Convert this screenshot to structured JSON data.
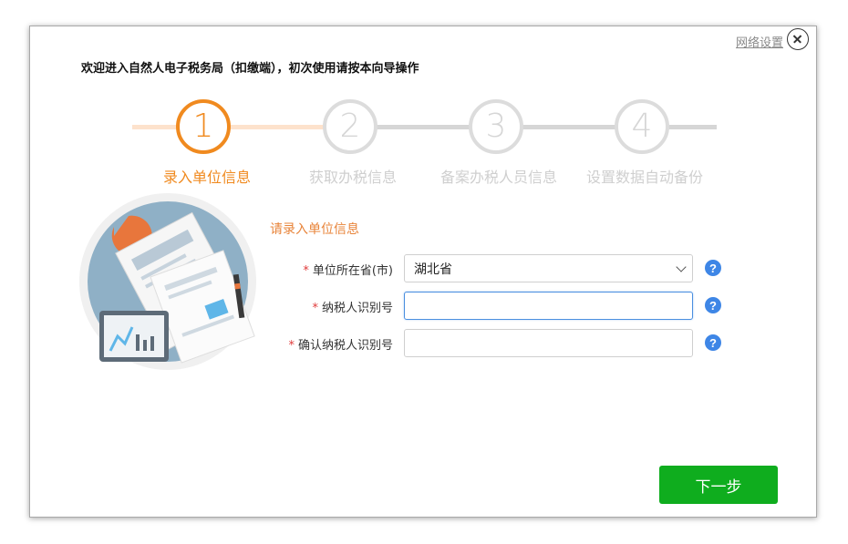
{
  "window": {
    "network_settings": "网络设置",
    "welcome": "欢迎进入自然人电子税务局（扣缴端），初次使用请按本向导操作"
  },
  "steps": [
    {
      "number": "1",
      "label": "录入单位信息",
      "active": true
    },
    {
      "number": "2",
      "label": "获取办税信息",
      "active": false
    },
    {
      "number": "3",
      "label": "备案办税人员信息",
      "active": false
    },
    {
      "number": "4",
      "label": "设置数据自动备份",
      "active": false
    }
  ],
  "form": {
    "section_title": "请录入单位信息",
    "required_mark": "*",
    "province": {
      "label": "单位所在省(市)",
      "value": "湖北省"
    },
    "taxpayer_id": {
      "label": "纳税人识别号",
      "value": ""
    },
    "confirm_taxpayer_id": {
      "label": "确认纳税人识别号",
      "value": ""
    },
    "help_glyph": "?"
  },
  "next_button": "下一步",
  "colors": {
    "accent_orange": "#f08a1f",
    "primary_green": "#0fad1e",
    "help_blue": "#3e86e6"
  }
}
